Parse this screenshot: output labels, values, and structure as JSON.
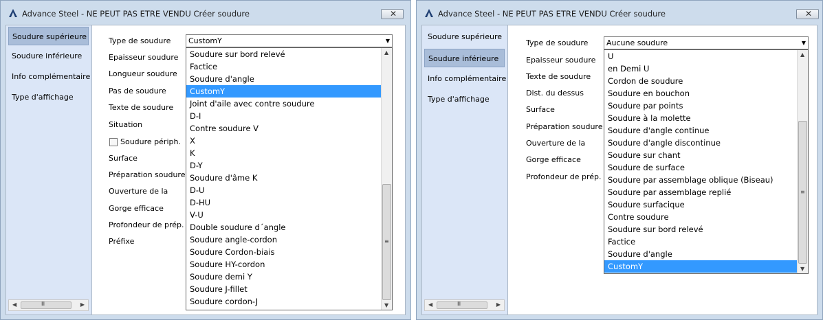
{
  "left_window": {
    "title": "Advance Steel - NE PEUT PAS ETRE VENDU   Créer soudure",
    "close_label": "✕",
    "nav": {
      "items": [
        "Soudure supérieure",
        "Soudure inférieure",
        "Info complémentaire",
        "Type d'affichage"
      ],
      "active": "Soudure supérieure"
    },
    "hscroll_grip": "III",
    "fields": {
      "type_label": "Type de soudure",
      "type_value": "CustomY",
      "labels": [
        "Epaisseur soudure",
        "Longueur soudure",
        "Pas de soudure",
        "Texte de soudure",
        "Situation"
      ],
      "checkbox_label": "Soudure périph.",
      "checkbox_checked": false,
      "labels_after": [
        "Surface",
        "Préparation soudure",
        "Ouverture de la",
        "Gorge efficace",
        "Profondeur de prép.",
        "Préfixe"
      ]
    },
    "dropdown": {
      "items": [
        "Soudure sur bord relevé",
        "Factice",
        "Soudure d'angle",
        "CustomY",
        "Joint d'aile avec contre soudure",
        "D-I",
        "Contre soudure V",
        "X",
        "K",
        "D-Y",
        "Soudure d'âme K",
        "D-U",
        "D-HU",
        "V-U",
        "Double soudure d´angle",
        "Soudure angle-cordon",
        "Soudure Cordon-biais",
        "Soudure HY-cordon",
        "Soudure demi Y",
        "Soudure J-fillet",
        "Soudure cordon-J"
      ],
      "selected": "CustomY",
      "scroll_grip": "≡",
      "scroll_thumb_start": 0.52,
      "scroll_thumb_end": 1.0
    }
  },
  "right_window": {
    "title": "Advance Steel - NE PEUT PAS ETRE VENDU   Créer soudure",
    "close_label": "✕",
    "nav": {
      "items": [
        "Soudure supérieure",
        "Soudure inférieure",
        "Info complémentaire",
        "Type d'affichage"
      ],
      "active": "Soudure inférieure"
    },
    "hscroll_grip": "III",
    "fields": {
      "type_label": "Type de soudure",
      "type_value": "Aucune soudure",
      "labels": [
        "Epaisseur soudure",
        "Texte de soudure",
        "Dist. du dessus",
        "Surface",
        "Préparation soudure",
        "Ouverture de la",
        "Gorge efficace",
        "Profondeur de prép."
      ]
    },
    "dropdown": {
      "items": [
        "U",
        "en Demi U",
        "Cordon de soudure",
        "Soudure en bouchon",
        "Soudure par points",
        "Soudure à la molette",
        "Soudure d'angle continue",
        "Soudure d'angle discontinue",
        "Soudure sur chant",
        "Soudure de surface",
        "Soudure par assemblage oblique (Biseau)",
        "Soudure par assemblage replié",
        "Soudure surfacique",
        "Contre soudure",
        "Soudure sur bord relevé",
        "Factice",
        "Soudure d'angle",
        "CustomY"
      ],
      "selected": "CustomY",
      "scroll_grip": "≡",
      "scroll_thumb_start": 0.3,
      "scroll_thumb_end": 1.0
    }
  },
  "colors": {
    "selection": "#3399ff",
    "nav_background": "#dbe6f7",
    "nav_active": "#a9bdd9",
    "frame": "#cddcec"
  },
  "icons": {
    "title_logo": "advance-steel-logo-icon",
    "close": "close-icon",
    "dropdown": "chevron-down-icon",
    "scroll_up": "scroll-up-arrow-icon",
    "scroll_down": "scroll-down-arrow-icon",
    "scroll_left": "scroll-left-arrow-icon",
    "scroll_right": "scroll-right-arrow-icon"
  }
}
